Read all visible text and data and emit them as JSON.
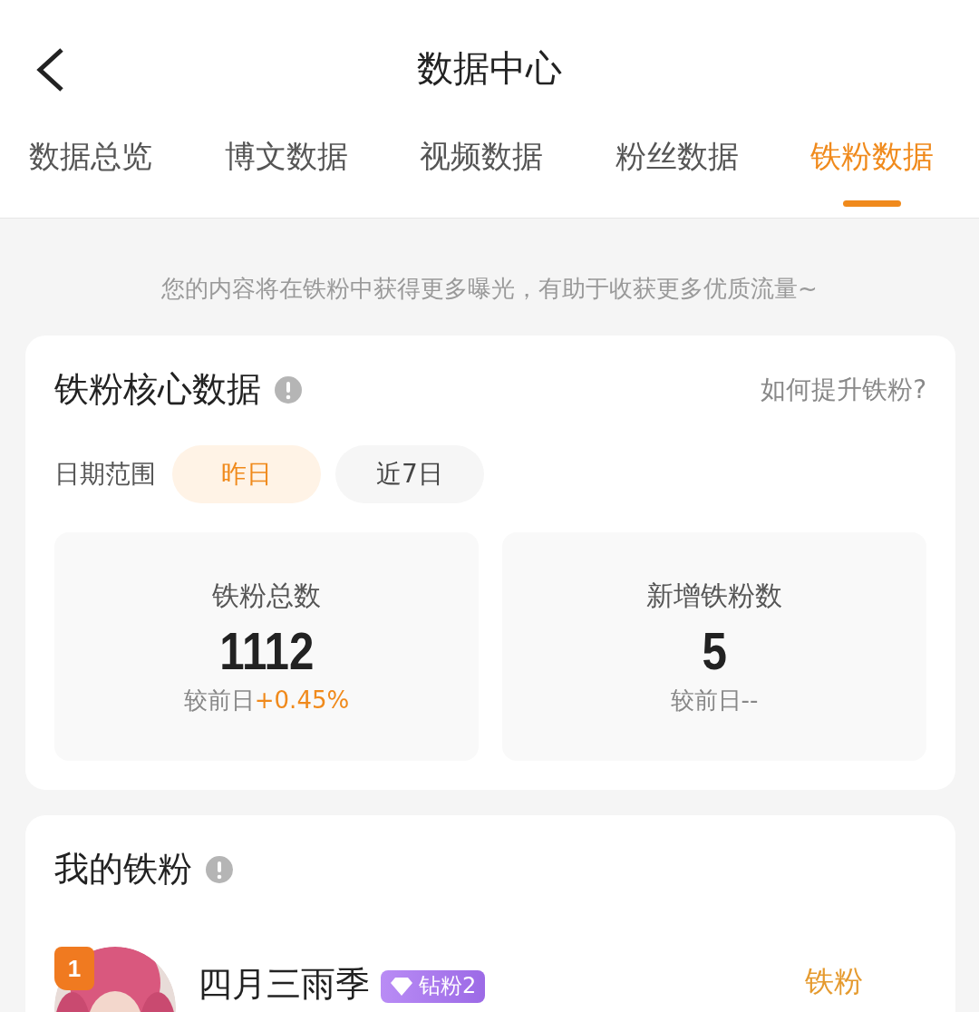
{
  "header": {
    "title": "数据中心"
  },
  "tabs": [
    {
      "label": "数据总览",
      "selected": false
    },
    {
      "label": "博文数据",
      "selected": false
    },
    {
      "label": "视频数据",
      "selected": false
    },
    {
      "label": "粉丝数据",
      "selected": false
    },
    {
      "label": "铁粉数据",
      "selected": true
    }
  ],
  "notice": "您的内容将在铁粉中获得更多曝光，有助于收获更多优质流量~",
  "core_card": {
    "title": "铁粉核心数据",
    "help_link": "如何提升铁粉?",
    "date_range_label": "日期范围",
    "ranges": [
      {
        "label": "昨日",
        "selected": true
      },
      {
        "label": "近7日",
        "selected": false
      }
    ],
    "metrics": [
      {
        "label": "铁粉总数",
        "value": "1112",
        "compare_label": "较前日",
        "change": "+0.45%",
        "highlight": true
      },
      {
        "label": "新增铁粉数",
        "value": "5",
        "compare_label": "较前日",
        "change": "--",
        "highlight": false
      }
    ]
  },
  "fans_card": {
    "title": "我的铁粉",
    "fans": [
      {
        "rank": "1",
        "name": "四月三雨季",
        "badge": "钻粉2",
        "status": "铁粉"
      }
    ]
  }
}
